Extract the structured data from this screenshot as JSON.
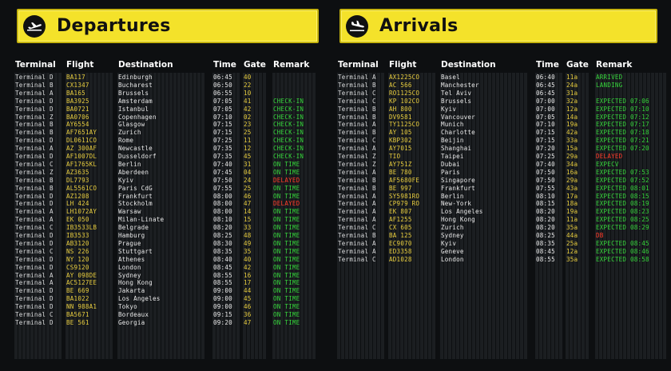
{
  "departures": {
    "title": "Departures",
    "icon": "plane-takeoff-icon",
    "headers": {
      "terminal": "Terminal",
      "flight": "Flight",
      "destination": "Destination",
      "time": "Time",
      "gate": "Gate",
      "remark": "Remark"
    },
    "rows": [
      {
        "terminal": "Terminal D",
        "flight": "BA117",
        "destination": "Edinburgh",
        "time": "06:45",
        "gate": "40",
        "remark": "",
        "remark_color": "white"
      },
      {
        "terminal": "Terminal B",
        "flight": "CX1347",
        "destination": "Bucharest",
        "time": "06:50",
        "gate": "22",
        "remark": "",
        "remark_color": "white"
      },
      {
        "terminal": "Terminal A",
        "flight": "BA165",
        "destination": "Brussels",
        "time": "06:55",
        "gate": "10",
        "remark": "",
        "remark_color": "white"
      },
      {
        "terminal": "Terminal D",
        "flight": "BA3925",
        "destination": "Amsterdam",
        "time": "07:05",
        "gate": "41",
        "remark": "CHECK-IN",
        "remark_color": "green"
      },
      {
        "terminal": "Terminal D",
        "flight": "BA0721",
        "destination": "Istanbul",
        "time": "07:05",
        "gate": "42",
        "remark": "CHECK-IN",
        "remark_color": "green"
      },
      {
        "terminal": "Terminal Z",
        "flight": "BA0706",
        "destination": "Copenhagen",
        "time": "07:10",
        "gate": "02",
        "remark": "CHECK-IN",
        "remark_color": "green"
      },
      {
        "terminal": "Terminal B",
        "flight": "AY6554",
        "destination": "Glasgow",
        "time": "07:15",
        "gate": "23",
        "remark": "CHECK-IN",
        "remark_color": "green"
      },
      {
        "terminal": "Terminal B",
        "flight": "AF7651AY",
        "destination": "Zurich",
        "time": "07:15",
        "gate": "25",
        "remark": "CHECK-IN",
        "remark_color": "green"
      },
      {
        "terminal": "Terminal D",
        "flight": "DL0611CO",
        "destination": "Rome",
        "time": "07:25",
        "gate": "11",
        "remark": "CHECK-IN",
        "remark_color": "green"
      },
      {
        "terminal": "Terminal A",
        "flight": "AZ 300AF",
        "destination": "Newcastle",
        "time": "07:35",
        "gate": "12",
        "remark": "CHECK-IN",
        "remark_color": "green"
      },
      {
        "terminal": "Terminal D",
        "flight": "AF1007DL",
        "destination": "Dusseldorf",
        "time": "07:35",
        "gate": "45",
        "remark": "CHECK-IN",
        "remark_color": "green"
      },
      {
        "terminal": "Terminal C",
        "flight": "AF1765KL",
        "destination": "Berlin",
        "time": "07:40",
        "gate": "31",
        "remark": "ON TIME",
        "remark_color": "green"
      },
      {
        "terminal": "Terminal Z",
        "flight": "AZ3635",
        "destination": "Aberdeen",
        "time": "07:45",
        "gate": "04",
        "remark": "ON TIME",
        "remark_color": "green"
      },
      {
        "terminal": "Terminal B",
        "flight": "DL7793",
        "destination": "Kyiv",
        "time": "07:50",
        "gate": "24",
        "remark": "DELAYED",
        "remark_color": "red"
      },
      {
        "terminal": "Terminal B",
        "flight": "AL5561CO",
        "destination": "Paris CdG",
        "time": "07:55",
        "gate": "25",
        "remark": "ON TIME",
        "remark_color": "green"
      },
      {
        "terminal": "Terminal D",
        "flight": "AZ1208",
        "destination": "Frankfurt",
        "time": "08:00",
        "gate": "46",
        "remark": "ON TIME",
        "remark_color": "green"
      },
      {
        "terminal": "Terminal D",
        "flight": "LH 424",
        "destination": "Stockholm",
        "time": "08:00",
        "gate": "47",
        "remark": "DELAYED",
        "remark_color": "red"
      },
      {
        "terminal": "Terminal A",
        "flight": "LH1072AY",
        "destination": "Warsaw",
        "time": "08:00",
        "gate": "14",
        "remark": "ON TIME",
        "remark_color": "green"
      },
      {
        "terminal": "Terminal A",
        "flight": "EK 050",
        "destination": "Milan-Linate",
        "time": "08:10",
        "gate": "15",
        "remark": "ON TIME",
        "remark_color": "green"
      },
      {
        "terminal": "Terminal C",
        "flight": "IB3533LB",
        "destination": "Belgrade",
        "time": "08:20",
        "gate": "33",
        "remark": "ON TIME",
        "remark_color": "green"
      },
      {
        "terminal": "Terminal D",
        "flight": "IB3533",
        "destination": "Hamburg",
        "time": "08:25",
        "gate": "48",
        "remark": "ON TIME",
        "remark_color": "green"
      },
      {
        "terminal": "Terminal D",
        "flight": "AB3120",
        "destination": "Prague",
        "time": "08:30",
        "gate": "49",
        "remark": "ON TIME",
        "remark_color": "green"
      },
      {
        "terminal": "Terminal C",
        "flight": "NS 226",
        "destination": "Stuttgart",
        "time": "08:35",
        "gate": "35",
        "remark": "ON TIME",
        "remark_color": "green"
      },
      {
        "terminal": "Terminal D",
        "flight": "NY 120",
        "destination": "Athenes",
        "time": "08:40",
        "gate": "40",
        "remark": "ON TIME",
        "remark_color": "green"
      },
      {
        "terminal": "Terminal D",
        "flight": "CS9120",
        "destination": "London",
        "time": "08:45",
        "gate": "42",
        "remark": "ON TIME",
        "remark_color": "green"
      },
      {
        "terminal": "Terminal A",
        "flight": "AY 098DE",
        "destination": "Sydney",
        "time": "08:55",
        "gate": "16",
        "remark": "ON TIME",
        "remark_color": "green"
      },
      {
        "terminal": "Terminal A",
        "flight": "AC5127EE",
        "destination": "Hong Kong",
        "time": "08:55",
        "gate": "17",
        "remark": "ON TIME",
        "remark_color": "green"
      },
      {
        "terminal": "Terminal D",
        "flight": "BE 669",
        "destination": "Jakarta",
        "time": "09:00",
        "gate": "44",
        "remark": "ON TIME",
        "remark_color": "green"
      },
      {
        "terminal": "Terminal D",
        "flight": "BA1022",
        "destination": "Los Angeles",
        "time": "09:00",
        "gate": "45",
        "remark": "ON TIME",
        "remark_color": "green"
      },
      {
        "terminal": "Terminal D",
        "flight": "NN 988A1",
        "destination": "Tokyo",
        "time": "09:00",
        "gate": "46",
        "remark": "ON TIME",
        "remark_color": "green"
      },
      {
        "terminal": "Terminal C",
        "flight": "BA5671",
        "destination": "Bordeaux",
        "time": "09:15",
        "gate": "36",
        "remark": "ON TIME",
        "remark_color": "green"
      },
      {
        "terminal": "Terminal D",
        "flight": "BE 561",
        "destination": "Georgia",
        "time": "09:20",
        "gate": "47",
        "remark": "ON TIME",
        "remark_color": "green"
      }
    ]
  },
  "arrivals": {
    "title": "Arrivals",
    "icon": "plane-landing-icon",
    "headers": {
      "terminal": "Terminal",
      "flight": "Flight",
      "destination": "Destination",
      "time": "Time",
      "gate": "Gate",
      "remark": "Remark"
    },
    "rows": [
      {
        "terminal": "Terminal A",
        "flight": "AX1225CO",
        "destination": "Basel",
        "time": "06:40",
        "gate": "11a",
        "remark": "ARRIVED",
        "remark_color": "green"
      },
      {
        "terminal": "Terminal B",
        "flight": "AC 566",
        "destination": "Manchester",
        "time": "06:45",
        "gate": "24a",
        "remark": "LANDING",
        "remark_color": "green"
      },
      {
        "terminal": "Terminal C",
        "flight": "RO1125CO",
        "destination": "Tel Aviv",
        "time": "06:45",
        "gate": "31a",
        "remark": "",
        "remark_color": "white"
      },
      {
        "terminal": "Terminal C",
        "flight": "KP 102CO",
        "destination": "Brussels",
        "time": "07:00",
        "gate": "32a",
        "remark": "EXPECTED 07:06",
        "remark_color": "green"
      },
      {
        "terminal": "Terminal B",
        "flight": "AH 800",
        "destination": "Kyiv",
        "time": "07:00",
        "gate": "12a",
        "remark": "EXPECTED 07:10",
        "remark_color": "green"
      },
      {
        "terminal": "Terminal B",
        "flight": "DV9581",
        "destination": "Vancouver",
        "time": "07:05",
        "gate": "14a",
        "remark": "EXPECTED 07:12",
        "remark_color": "green"
      },
      {
        "terminal": "Terminal A",
        "flight": "TY1125CO",
        "destination": "Munich",
        "time": "07:10",
        "gate": "19a",
        "remark": "EXPECTED 07:17",
        "remark_color": "green"
      },
      {
        "terminal": "Terminal B",
        "flight": "AY 105",
        "destination": "Charlotte",
        "time": "07:15",
        "gate": "42a",
        "remark": "EXPECTED 07:18",
        "remark_color": "green"
      },
      {
        "terminal": "Terminal C",
        "flight": "KBP302",
        "destination": "Beijin",
        "time": "07:15",
        "gate": "33a",
        "remark": "EXPECTED 07:21",
        "remark_color": "green"
      },
      {
        "terminal": "Terminal A",
        "flight": "AY7015",
        "destination": "Shanghai",
        "time": "07:20",
        "gate": "15a",
        "remark": "EXPECTED 07:20",
        "remark_color": "green"
      },
      {
        "terminal": "Terminal Z",
        "flight": "TIO",
        "destination": "Taipei",
        "time": "07:25",
        "gate": "29a",
        "remark": "DELAYED",
        "remark_color": "red"
      },
      {
        "terminal": "Terminal Z",
        "flight": "AY751Z",
        "destination": "Dubai",
        "time": "07:40",
        "gate": "34a",
        "remark": "EXPECV",
        "remark_color": "green"
      },
      {
        "terminal": "Terminal A",
        "flight": "BE 780",
        "destination": "Paris",
        "time": "07:50",
        "gate": "16a",
        "remark": "EXPECTED 07:53",
        "remark_color": "green"
      },
      {
        "terminal": "Terminal B",
        "flight": "AF5680FE",
        "destination": "Singapore",
        "time": "07:50",
        "gate": "29a",
        "remark": "EXPECTED 07:52",
        "remark_color": "green"
      },
      {
        "terminal": "Terminal B",
        "flight": "BE 997",
        "destination": "Frankfurt",
        "time": "07:55",
        "gate": "43a",
        "remark": "EXPECTED 08:01",
        "remark_color": "green"
      },
      {
        "terminal": "Terminal A",
        "flight": "SY5981RO",
        "destination": "Berlin",
        "time": "08:10",
        "gate": "17a",
        "remark": "EXPECTED 08:15",
        "remark_color": "green"
      },
      {
        "terminal": "Terminal A",
        "flight": "CP979 RO",
        "destination": "New-York",
        "time": "08:15",
        "gate": "18a",
        "remark": "EXPECTED 08:19",
        "remark_color": "green"
      },
      {
        "terminal": "Terminal A",
        "flight": "EK 807",
        "destination": "Los Angeles",
        "time": "08:20",
        "gate": "19a",
        "remark": "EXPECTED 08:23",
        "remark_color": "green"
      },
      {
        "terminal": "Terminal A",
        "flight": "AF1255",
        "destination": "Hong Kong",
        "time": "08:20",
        "gate": "11a",
        "remark": "EXPECTED 08:25",
        "remark_color": "green"
      },
      {
        "terminal": "Terminal C",
        "flight": "CX 605",
        "destination": "Zurich",
        "time": "08:20",
        "gate": "35a",
        "remark": "EXPECTED 08:29",
        "remark_color": "green"
      },
      {
        "terminal": "Terminal B",
        "flight": "BA 125",
        "destination": "Sydney",
        "time": "08:25",
        "gate": "44a",
        "remark": "DB",
        "remark_color": "red"
      },
      {
        "terminal": "Terminal A",
        "flight": "EC9070",
        "destination": "Kyiv",
        "time": "08:35",
        "gate": "25a",
        "remark": "EXPECTED 08:45",
        "remark_color": "green"
      },
      {
        "terminal": "Terminal A",
        "flight": "ED3358",
        "destination": "Geneve",
        "time": "08:45",
        "gate": "12a",
        "remark": "EXPECTED 08:46",
        "remark_color": "green"
      },
      {
        "terminal": "Terminal C",
        "flight": "AD1028",
        "destination": "London",
        "time": "08:55",
        "gate": "35a",
        "remark": "EXPECTED 08:58",
        "remark_color": "green"
      }
    ]
  }
}
